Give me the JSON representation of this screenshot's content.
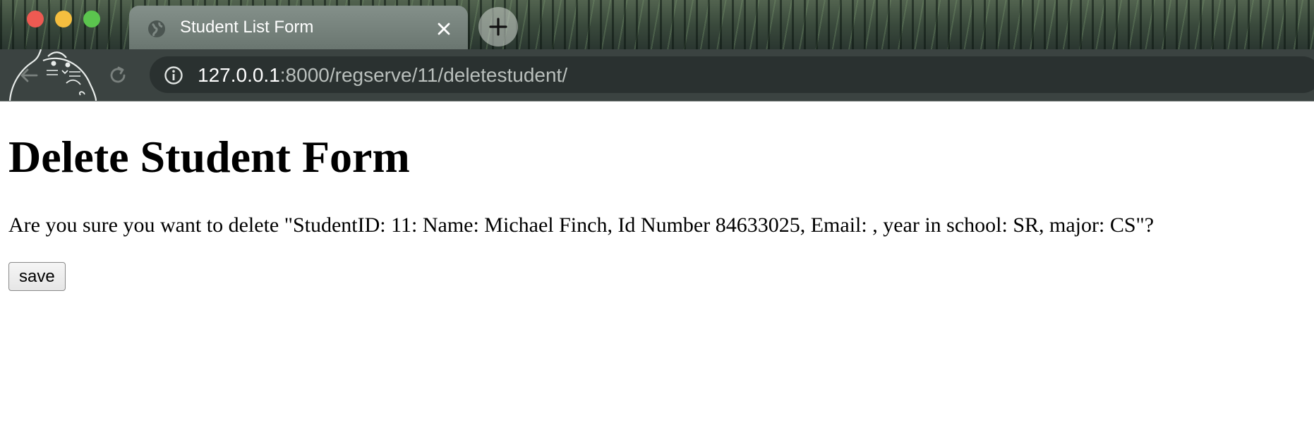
{
  "window": {
    "tab_title": "Student List Form",
    "address": {
      "host": "127.0.0.1",
      "path": ":8000/regserve/11/deletestudent/"
    }
  },
  "page": {
    "heading": "Delete Student Form",
    "confirm_text": "Are you sure you want to delete \"StudentID: 11: Name: Michael Finch, Id Number 84633025, Email: , year in school: SR, major: CS\"?",
    "save_label": "save"
  },
  "colors": {
    "traffic_close": "#ee5a52",
    "traffic_minimize": "#f5be3f",
    "traffic_maximize": "#5bc54e",
    "toolbar": "#3b4341"
  },
  "icons": [
    "globe-icon",
    "close-icon",
    "plus-icon",
    "back-arrow-icon",
    "reload-icon",
    "info-icon",
    "mascot-icon"
  ]
}
